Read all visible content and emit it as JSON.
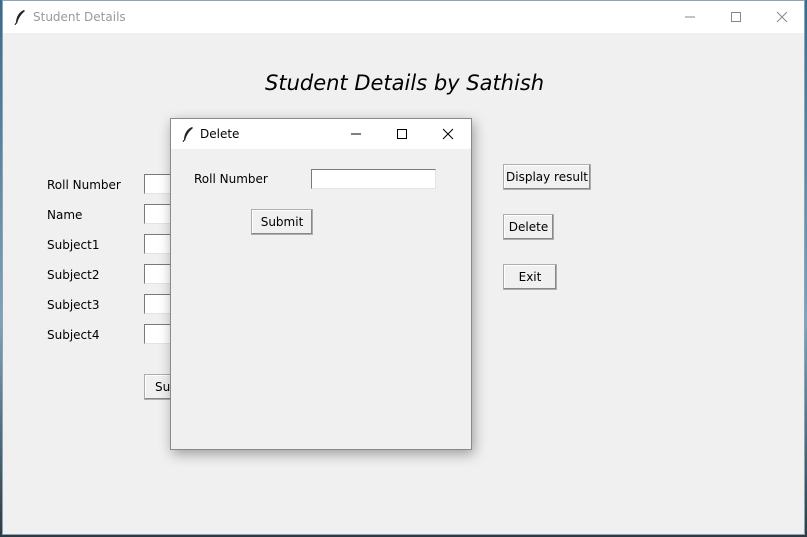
{
  "main_window": {
    "title": "Student Details",
    "heading": "Student Details by Sathish",
    "fields": [
      {
        "label": "Roll Number",
        "value": ""
      },
      {
        "label": "Name",
        "value": ""
      },
      {
        "label": "Subject1",
        "value": ""
      },
      {
        "label": "Subject2",
        "value": ""
      },
      {
        "label": "Subject3",
        "value": ""
      },
      {
        "label": "Subject4",
        "value": ""
      }
    ],
    "submit_label": "Submit",
    "buttons": {
      "display_result": "Display result",
      "delete": "Delete",
      "exit": "Exit"
    }
  },
  "delete_dialog": {
    "title": "Delete",
    "roll_number_label": "Roll Number",
    "roll_number_value": "",
    "submit_label": "Submit"
  },
  "icons": {
    "app_icon": "feather-icon",
    "minimize": "minimize-icon",
    "maximize": "maximize-icon",
    "close": "close-icon"
  }
}
